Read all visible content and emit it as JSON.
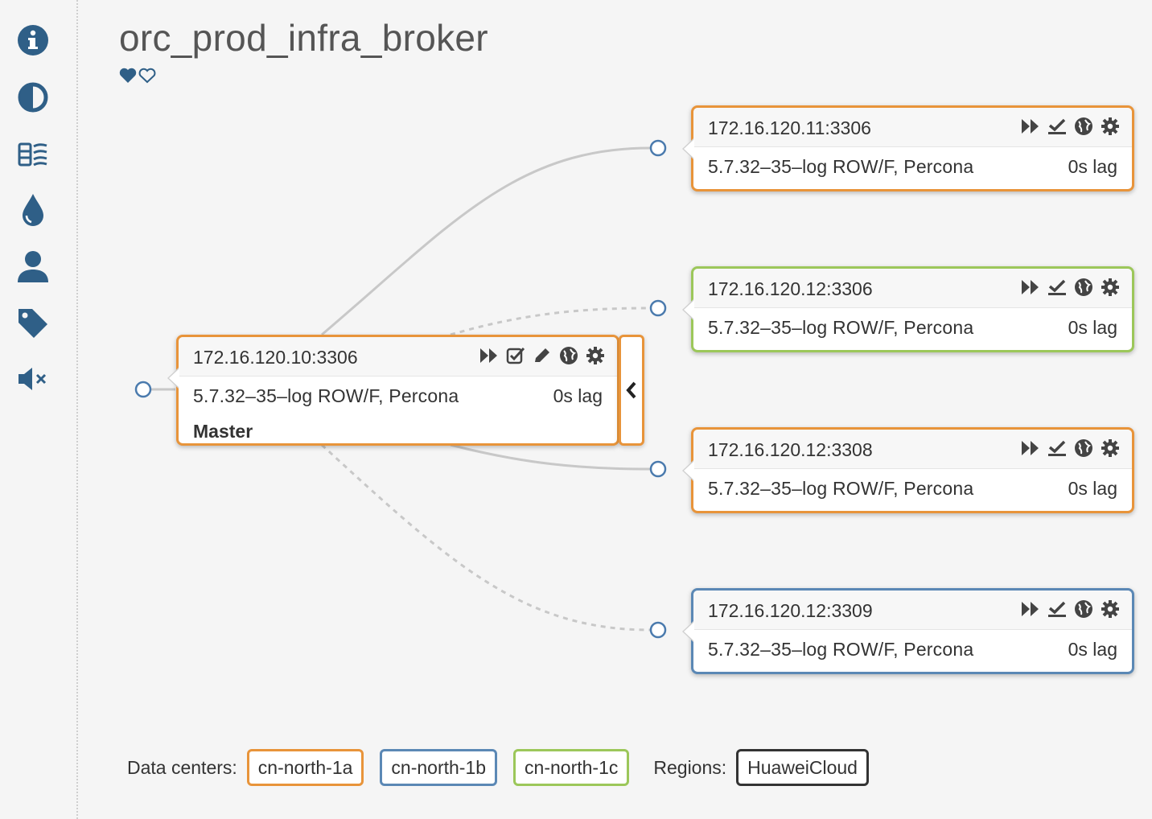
{
  "cluster": {
    "title": "orc_prod_infra_broker",
    "favorite_icons": [
      "heart-filled",
      "heart-outline"
    ]
  },
  "sidebar": {
    "items": [
      {
        "icon": "info-icon"
      },
      {
        "icon": "contrast-icon"
      },
      {
        "icon": "list-icon"
      },
      {
        "icon": "drop-icon"
      },
      {
        "icon": "user-icon"
      },
      {
        "icon": "tag-icon"
      },
      {
        "icon": "mute-icon"
      }
    ]
  },
  "colors": {
    "dc_a": "#e8943a",
    "dc_b": "#5b88b5",
    "dc_c": "#9cc75a",
    "icon": "#2f5f87"
  },
  "master": {
    "host": "172.16.120.10:3306",
    "version": "5.7.32–35–log ROW/F, Percona",
    "lag": "0s lag",
    "role": "Master",
    "datacenter": "cn-north-1a",
    "actions": [
      "forward-icon",
      "check-icon",
      "pencil-icon",
      "globe-icon",
      "gear-icon"
    ]
  },
  "replicas": [
    {
      "host": "172.16.120.11:3306",
      "version": "5.7.32–35–log ROW/F, Percona",
      "lag": "0s lag",
      "datacenter": "cn-north-1a",
      "link": "solid"
    },
    {
      "host": "172.16.120.12:3306",
      "version": "5.7.32–35–log ROW/F, Percona",
      "lag": "0s lag",
      "datacenter": "cn-north-1c",
      "link": "dashed"
    },
    {
      "host": "172.16.120.12:3308",
      "version": "5.7.32–35–log ROW/F, Percona",
      "lag": "0s lag",
      "datacenter": "cn-north-1a",
      "link": "solid"
    },
    {
      "host": "172.16.120.12:3309",
      "version": "5.7.32–35–log ROW/F, Percona",
      "lag": "0s lag",
      "datacenter": "cn-north-1b",
      "link": "dashed"
    }
  ],
  "legend": {
    "datacenters_label": "Data centers:",
    "datacenters": [
      "cn-north-1a",
      "cn-north-1b",
      "cn-north-1c"
    ],
    "regions_label": "Regions:",
    "regions": [
      "HuaweiCloud"
    ]
  }
}
